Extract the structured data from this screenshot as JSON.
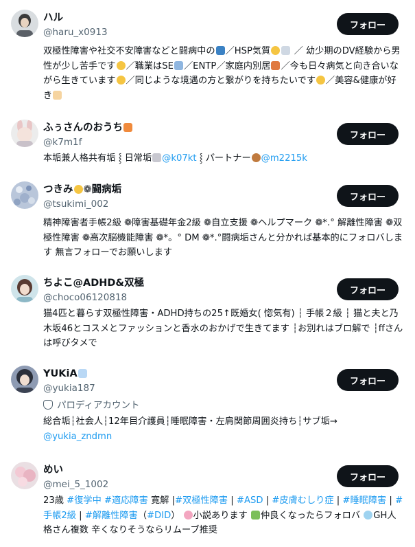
{
  "follow_label": "フォロー",
  "users": [
    {
      "name": "ハル",
      "handle": "@haru_x0913",
      "bio": [
        "双極性障害や社交不安障害などと闘病中の",
        "／HSP気質",
        " ／ 幼少期のDV経験から男性が少し苦手です",
        "／職業はSE",
        "／ENTP／家庭内別居",
        "／今も日々病気と向き合いながら生きています",
        "／同じような境遇の方と繋がりを持ちたいです",
        "／美容&健康が好き"
      ]
    },
    {
      "name": "ふぅさんのおうち",
      "handle": "@k7m1f",
      "bio": [
        "本垢兼人格共有垢",
        "日常垢",
        "@k07kt",
        "パートナー",
        "@m2215k"
      ]
    },
    {
      "name": "つきみ",
      "name_suffix": "闘病垢",
      "handle": "@tsukimi_002",
      "bio": "精神障害者手帳2級 ❁障害基礎年金2級 ❁自立支援 ❁ヘルプマーク ❁*.° 解離性障害 ❁双極性障害 ❁高次脳機能障害 ❁*。° DM ❁*.°闘病垢さんと分かれば基本的にフォロバします 無言フォローでお願いします"
    },
    {
      "name": "ちよこ@ADHD&双極",
      "handle": "@choco06120818",
      "bio": "猫4匹と暮らす双極性障害・ADHD持ちの25↑既婚女( 惚気有) ┆ 手帳２級 ┆ 猫と夫と乃木坂46とコスメとファッションと香水のおかげで生きてます ┆お別れはブロ解で ┆ffさんは呼びタメで"
    },
    {
      "name": "YUKiA",
      "handle": "@yukia187",
      "parody": "パロディアカウント",
      "bio": [
        "総合垢┆社会人┆12年目介護員┆睡眠障害・左肩関節周囲炎持ち┆サブ垢→",
        "@yukia_zndmn"
      ]
    },
    {
      "name": "めい",
      "handle": "@mei_5_1002",
      "bio": [
        "23歳",
        "#復学中",
        "#適応障害",
        "寛解 |",
        "#双極性障害",
        "|",
        "#ASD",
        "|",
        "#皮膚むしり症",
        "|",
        "#睡眠障害",
        "|",
        "#手帳2級",
        "|",
        "#解離性障害",
        "（",
        "#DID",
        "）",
        "小説あります",
        "仲良くなったらフォロバ",
        "GH人格さん複数 辛くなりそうならリムーブ推奨"
      ]
    }
  ]
}
